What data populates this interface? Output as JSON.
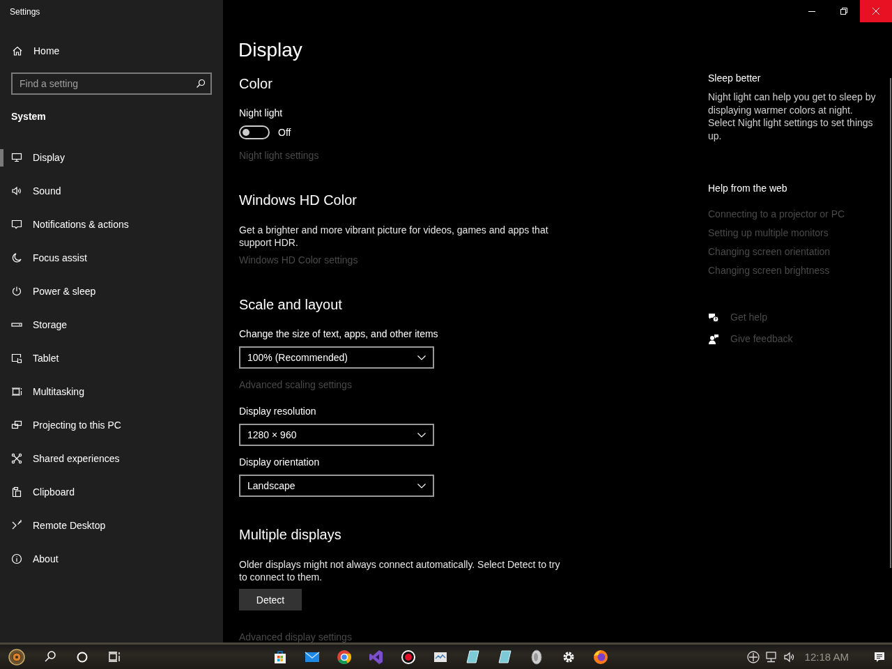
{
  "window": {
    "title": "Settings"
  },
  "sidebar": {
    "home": "Home",
    "search": {
      "placeholder": "Find a setting"
    },
    "section": "System",
    "items": [
      {
        "label": "Display",
        "selected": true
      },
      {
        "label": "Sound",
        "selected": false
      },
      {
        "label": "Notifications & actions",
        "selected": false
      },
      {
        "label": "Focus assist",
        "selected": false
      },
      {
        "label": "Power & sleep",
        "selected": false
      },
      {
        "label": "Storage",
        "selected": false
      },
      {
        "label": "Tablet",
        "selected": false
      },
      {
        "label": "Multitasking",
        "selected": false
      },
      {
        "label": "Projecting to this PC",
        "selected": false
      },
      {
        "label": "Shared experiences",
        "selected": false
      },
      {
        "label": "Clipboard",
        "selected": false
      },
      {
        "label": "Remote Desktop",
        "selected": false
      },
      {
        "label": "About",
        "selected": false
      }
    ]
  },
  "page": {
    "title": "Display",
    "blocks": [
      {
        "kind": "heading",
        "text": "Color"
      },
      {
        "kind": "label",
        "text": "Night light"
      },
      {
        "kind": "toggle",
        "on": false,
        "text": "Off"
      },
      {
        "kind": "link",
        "text": "Night light settings",
        "disabled": true
      },
      {
        "kind": "heading",
        "text": "Windows HD Color"
      },
      {
        "kind": "text",
        "text": "Get a brighter and more vibrant picture for videos, games and apps that support HDR."
      },
      {
        "kind": "link",
        "text": "Windows HD Color settings",
        "disabled": true
      },
      {
        "kind": "heading",
        "text": "Scale and layout"
      },
      {
        "kind": "label",
        "text": "Change the size of text, apps, and other items"
      },
      {
        "kind": "dropdown",
        "value": "100% (Recommended)"
      },
      {
        "kind": "link",
        "text": "Advanced scaling settings",
        "disabled": true
      },
      {
        "kind": "label",
        "text": "Display resolution"
      },
      {
        "kind": "dropdown",
        "value": "1280 × 960"
      },
      {
        "kind": "label",
        "text": "Display orientation"
      },
      {
        "kind": "dropdown",
        "value": "Landscape"
      },
      {
        "kind": "heading",
        "text": "Multiple displays"
      },
      {
        "kind": "text",
        "text": "Older displays might not always connect automatically. Select Detect to try to connect to them."
      },
      {
        "kind": "button",
        "text": "Detect"
      },
      {
        "kind": "link",
        "text": "Advanced display settings",
        "disabled": true
      }
    ]
  },
  "aside": {
    "sleep": {
      "title": "Sleep better",
      "text": "Night light can help you get to sleep by displaying warmer colors at night. Select Night light settings to set things up."
    },
    "help": {
      "title": "Help from the web",
      "links": [
        {
          "text": "Connecting to a projector or PC",
          "disabled": true
        },
        {
          "text": "Setting up multiple monitors",
          "disabled": true
        },
        {
          "text": "Changing screen orientation",
          "disabled": true
        },
        {
          "text": "Changing screen brightness",
          "disabled": true
        }
      ]
    },
    "actions": [
      {
        "text": "Get help",
        "disabled": true
      },
      {
        "text": "Give feedback",
        "disabled": true
      }
    ]
  },
  "taskbar": {
    "clock": "12:18 AM"
  }
}
